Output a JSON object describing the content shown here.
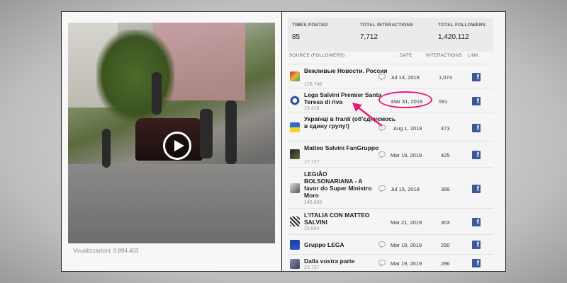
{
  "video": {
    "views_text": "Visualizzazioni: 9.894.403",
    "play_icon": "play-icon"
  },
  "stats": {
    "times_posted_label": "TIMES POSTED",
    "times_posted_value": "85",
    "total_interactions_label": "TOTAL INTERACTIONS",
    "total_interactions_value": "7,712",
    "total_followers_label": "TOTAL FOLLOWERS",
    "total_followers_value": "1,420,112"
  },
  "table": {
    "headers": {
      "source": "SOURCE (FOLLOWERS)",
      "date": "DATE",
      "interactions": "INTERACTIONS",
      "link": "LINK"
    },
    "rows": [
      {
        "name": "Вежливые Новости. Россия",
        "followers": "128,746",
        "date": "Jul 14, 2018",
        "interactions": "1,074",
        "has_comment": true
      },
      {
        "name": "Lega Salvini Premier Santa Teresa di riva",
        "followers": "15,418",
        "date": "Mar 31, 2019",
        "interactions": "591",
        "has_comment": false
      },
      {
        "name": "Українці в Італії (об'єднуємось в єдину групу!)",
        "followers": "",
        "date": "Aug 1, 2018",
        "interactions": "473",
        "has_comment": true
      },
      {
        "name": "Matteo Salvini FanGruppo",
        "followers": "17,727",
        "date": "Mar 19, 2019",
        "interactions": "425",
        "has_comment": true
      },
      {
        "name": "LEGIÃO BOLSONARIANA - A favor do Super Ministro Moro",
        "followers": "148,860",
        "date": "Jul 15, 2018",
        "interactions": "389",
        "has_comment": true
      },
      {
        "name": "L'ITALIA CON MATTEO SALVINI",
        "followers": "15,694",
        "date": "Mar 21, 2019",
        "interactions": "303",
        "has_comment": false
      },
      {
        "name": "Gruppo LEGA",
        "followers": "",
        "date": "Mar 19, 2019",
        "interactions": "290",
        "has_comment": true
      },
      {
        "name": "Dalla vostra parte",
        "followers": "23,737",
        "date": "Mar 19, 2019",
        "interactions": "286",
        "has_comment": true
      }
    ]
  },
  "link_icon_glyph": "f",
  "colors": {
    "facebook": "#3b5998",
    "highlight": "#e6197a"
  }
}
